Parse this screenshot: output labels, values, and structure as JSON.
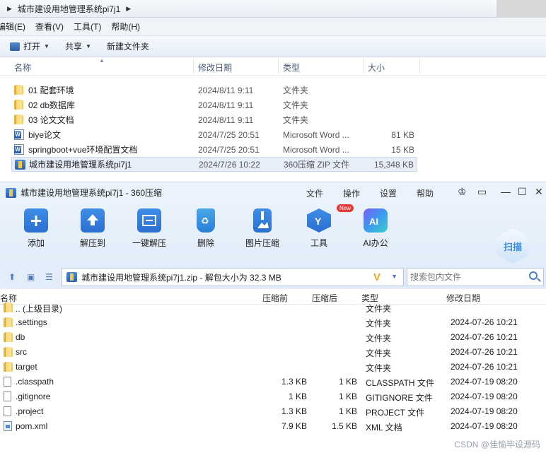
{
  "explorer": {
    "breadcrumb": "城市建设用地管理系统pi7j1",
    "menu": [
      "编辑(E)",
      "查看(V)",
      "工具(T)",
      "帮助(H)"
    ],
    "toolbar": {
      "open": "打开",
      "share": "共享",
      "new_folder": "新建文件夹"
    },
    "columns": {
      "name": "名称",
      "date": "修改日期",
      "type": "类型",
      "size": "大小"
    },
    "rows": [
      {
        "name": "01 配套环境",
        "date": "2024/8/11 9:11",
        "type": "文件夹",
        "size": "",
        "icon": "folder-icon"
      },
      {
        "name": "02 db数据库",
        "date": "2024/8/11 9:11",
        "type": "文件夹",
        "size": "",
        "icon": "folder-icon"
      },
      {
        "name": "03 论文文档",
        "date": "2024/8/11 9:11",
        "type": "文件夹",
        "size": "",
        "icon": "folder-icon"
      },
      {
        "name": "biye论文",
        "date": "2024/7/25 20:51",
        "type": "Microsoft Word ...",
        "size": "81 KB",
        "icon": "word-doc-icon"
      },
      {
        "name": "springboot+vue环境配置文档",
        "date": "2024/7/25 20:51",
        "type": "Microsoft Word ...",
        "size": "15 KB",
        "icon": "word-doc-icon"
      },
      {
        "name": "城市建设用地管理系统pi7j1",
        "date": "2024/7/26 10:22",
        "type": "360压缩 ZIP 文件",
        "size": "15,348 KB",
        "icon": "zip-archive-icon"
      }
    ]
  },
  "zip": {
    "title": "城市建设用地管理系统pi7j1 - 360压缩",
    "menu": [
      "文件",
      "操作",
      "设置",
      "帮助"
    ],
    "ribbon": [
      {
        "label": "添加",
        "icon": "add-icon"
      },
      {
        "label": "解压到",
        "icon": "extract-to-icon"
      },
      {
        "label": "一键解压",
        "icon": "one-click-extract-icon"
      },
      {
        "label": "删除",
        "icon": "trash-icon"
      },
      {
        "label": "图片压缩",
        "icon": "image-compress-icon"
      },
      {
        "label": "工具",
        "icon": "tools-icon"
      },
      {
        "label": "AI办公",
        "icon": "ai-office-icon"
      }
    ],
    "new_badge": "New",
    "scan_label": "扫描",
    "path": "城市建设用地管理系统pi7j1.zip - 解包大小为 32.3 MB",
    "search_placeholder": "搜索包内文件",
    "columns": {
      "name": "名称",
      "compressed": "压缩前",
      "uncompressed": "压缩后",
      "type": "类型",
      "date": "修改日期"
    },
    "rows": [
      {
        "name": ".. (上级目录)",
        "csz": "",
        "usz": "",
        "type": "文件夹",
        "date": "",
        "icon": "folder-icon"
      },
      {
        "name": ".settings",
        "csz": "",
        "usz": "",
        "type": "文件夹",
        "date": "2024-07-26 10:21",
        "icon": "folder-icon"
      },
      {
        "name": "db",
        "csz": "",
        "usz": "",
        "type": "文件夹",
        "date": "2024-07-26 10:21",
        "icon": "folder-icon"
      },
      {
        "name": "src",
        "csz": "",
        "usz": "",
        "type": "文件夹",
        "date": "2024-07-26 10:21",
        "icon": "folder-icon"
      },
      {
        "name": "target",
        "csz": "",
        "usz": "",
        "type": "文件夹",
        "date": "2024-07-26 10:21",
        "icon": "folder-icon"
      },
      {
        "name": ".classpath",
        "csz": "1.3 KB",
        "usz": "1 KB",
        "type": "CLASSPATH 文件",
        "date": "2024-07-19 08:20",
        "icon": "file-icon"
      },
      {
        "name": ".gitignore",
        "csz": "1 KB",
        "usz": "1 KB",
        "type": "GITIGNORE 文件",
        "date": "2024-07-19 08:20",
        "icon": "file-icon"
      },
      {
        "name": ".project",
        "csz": "1.3 KB",
        "usz": "1 KB",
        "type": "PROJECT 文件",
        "date": "2024-07-19 08:20",
        "icon": "file-icon"
      },
      {
        "name": "pom.xml",
        "csz": "7.9 KB",
        "usz": "1.5 KB",
        "type": "XML 文档",
        "date": "2024-07-19 08:20",
        "icon": "xml-file-icon"
      }
    ]
  },
  "watermark": "CSDN @佳愉毕设源码",
  "colors": {
    "accent": "#2f7fd6",
    "selection": "#e8eef9",
    "ribbon_bg": "#e2edf9"
  }
}
